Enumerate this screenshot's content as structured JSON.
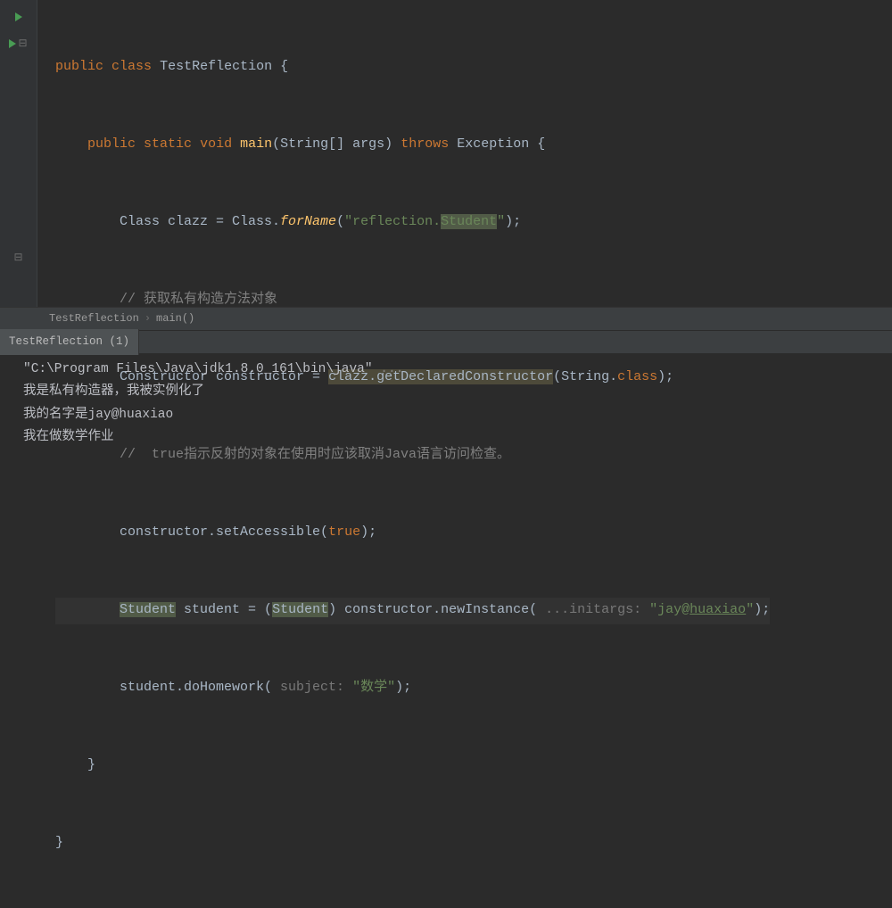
{
  "code": {
    "line1": {
      "kw1": "public",
      "kw2": "class",
      "name": "TestReflection",
      "brace": "{"
    },
    "line2": {
      "kw1": "public",
      "kw2": "static",
      "kw3": "void",
      "method": "main",
      "args_open": "(",
      "argtype": "String[] args",
      "args_close": ")",
      "throws": "throws",
      "exc": "Exception",
      "brace": "{"
    },
    "line3": {
      "text1": "Class clazz = Class.",
      "method": "forName",
      "paren_open": "(",
      "str1": "\"reflection.",
      "str2": "Student",
      "str3": "\"",
      "paren_close": ")",
      "semi": ";"
    },
    "line4": {
      "cmt": "// 获取私有构造方法对象"
    },
    "line5": {
      "text1": "Constructor constructor = ",
      "hl": "clazz.getDeclaredConstructor",
      "paren_open": "(",
      "arg": "String.",
      "kw": "class",
      "paren_close": ")",
      "semi": ";"
    },
    "line6": {
      "cmt": "//  true指示反射的对象在使用时应该取消Java语言访问检查。"
    },
    "line7": {
      "text1": "constructor.setAccessible(",
      "kw": "true",
      "close": ");"
    },
    "line8": {
      "hl1": "Student",
      "text1": " student = (",
      "hl2": "Student",
      "text2": ") constructor.newInstance( ",
      "ann": "...initargs:",
      "str1": " \"jay@",
      "link": "huaxiao",
      "str2": "\"",
      "close": ");"
    },
    "line9": {
      "text1": "student.doHomework( ",
      "ann": "subject:",
      "str": " \"数学\"",
      "close": ");"
    },
    "line10": {
      "brace": "}"
    },
    "line11": {
      "brace": "}"
    }
  },
  "breadcrumbs": {
    "item1": "TestReflection",
    "sep": "›",
    "item2": "main()"
  },
  "console_tab": "TestReflection (1)",
  "console": {
    "line1a": "\"C:\\Program Files\\Java\\jdk1.8.0_161\\bin\\java\" ",
    "line1b": "...",
    "line2": "我是私有构造器，我被实例化了",
    "line3": "我的名字是jay@huaxiao",
    "line4": "我在做数学作业"
  }
}
